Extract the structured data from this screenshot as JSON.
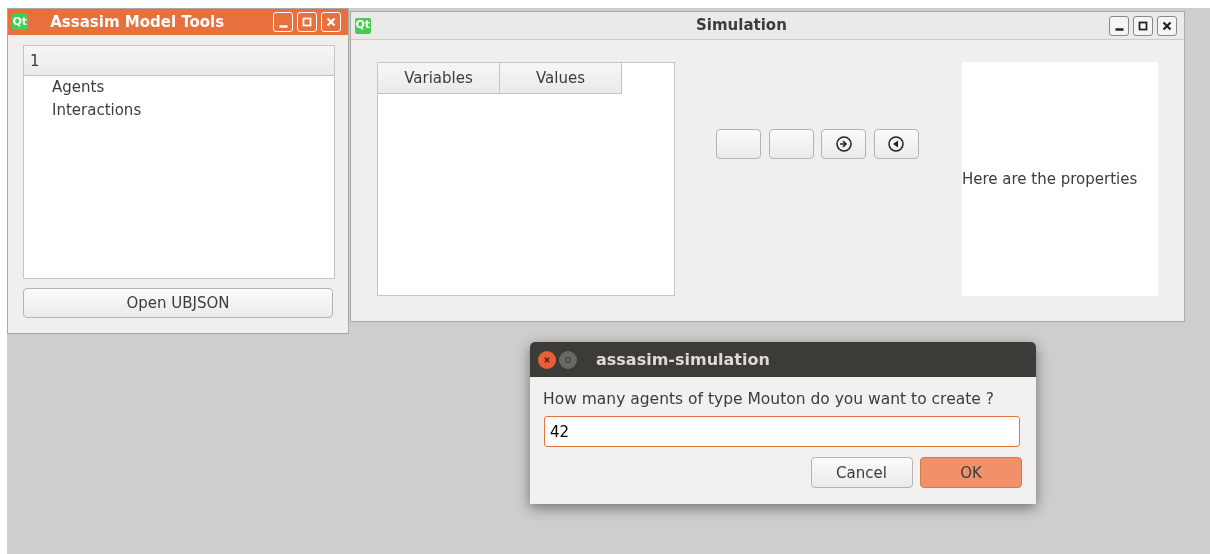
{
  "tools_window": {
    "logo": "Qt",
    "title": "Assasim Model Tools",
    "tree": {
      "header": "1",
      "items": [
        {
          "label": "Agents"
        },
        {
          "label": "Interactions"
        }
      ]
    },
    "open_button": "Open UBJSON"
  },
  "simulation_window": {
    "logo": "Qt",
    "title": "Simulation",
    "table": {
      "columns": [
        "Variables",
        "Values"
      ]
    },
    "tool_buttons": [
      {
        "kind": "blank"
      },
      {
        "kind": "blank"
      },
      {
        "kind": "forward"
      },
      {
        "kind": "back"
      }
    ],
    "properties_text": "Here are the properties"
  },
  "dialog": {
    "title": "assasim-simulation",
    "prompt": "How many agents of type Mouton do you want to create ?",
    "input": {
      "value": "42",
      "focused": true
    },
    "buttons": [
      {
        "label": "Cancel",
        "default": false
      },
      {
        "label": "OK",
        "default": true
      }
    ]
  }
}
